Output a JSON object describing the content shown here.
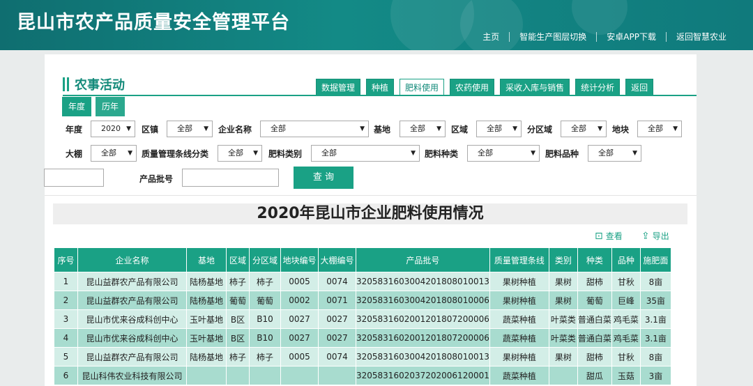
{
  "header": {
    "title": "昆山市农产品质量安全管理平台",
    "nav": [
      "主页",
      "智能生产图层切换",
      "安卓APP下载",
      "返回智慧农业"
    ]
  },
  "section": {
    "title": "农事活动"
  },
  "tabs": [
    {
      "label": "数据管理",
      "active": false
    },
    {
      "label": "种植",
      "active": false
    },
    {
      "label": "肥料使用",
      "active": true
    },
    {
      "label": "农药使用",
      "active": false
    },
    {
      "label": "采收入库与销售",
      "active": false
    },
    {
      "label": "统计分析",
      "active": false
    },
    {
      "label": "返回",
      "active": false
    }
  ],
  "year_tabs": [
    "年度",
    "历年"
  ],
  "filters": {
    "year": {
      "label": "年度",
      "value": "2020"
    },
    "town": {
      "label": "区镇",
      "value": "全部"
    },
    "company": {
      "label": "企业名称",
      "value": "全部"
    },
    "base": {
      "label": "基地",
      "value": "全部"
    },
    "zone": {
      "label": "区域",
      "value": "全部"
    },
    "subzone": {
      "label": "分区域",
      "value": "全部"
    },
    "plot": {
      "label": "地块",
      "value": "全部"
    },
    "greenhouse": {
      "label": "大棚",
      "value": "全部"
    },
    "quality_line": {
      "label": "质量管理条线分类",
      "value": "全部"
    },
    "fert_class": {
      "label": "肥料类别",
      "value": "全部"
    },
    "fert_kind": {
      "label": "肥料种类",
      "value": "全部"
    },
    "fert_variety": {
      "label": "肥料品种",
      "value": "全部"
    },
    "batch": {
      "label": "产品批号",
      "value": ""
    },
    "query_label": "查 询"
  },
  "report": {
    "title": "2020年昆山市企业肥料使用情况",
    "view_label": "查看",
    "export_label": "导出"
  },
  "table": {
    "headers": [
      "序号",
      "企业名称",
      "基地",
      "区域",
      "分区域",
      "地块编号",
      "大棚编号",
      "产品批号",
      "质量管理条线",
      "类别",
      "种类",
      "品种",
      "施肥面"
    ],
    "rows": [
      [
        "1",
        "昆山益群农产品有限公司",
        "陆杨基地",
        "柿子",
        "柿子",
        "0005",
        "0074",
        "320583160300420180801001​3",
        "果树种植",
        "果树",
        "甜柿",
        "甘秋",
        "8亩"
      ],
      [
        "2",
        "昆山益群农产品有限公司",
        "陆杨基地",
        "葡萄",
        "葡萄",
        "0002",
        "0071",
        "320583160300420180801000​6",
        "果树种植",
        "果树",
        "葡萄",
        "巨峰",
        "35亩"
      ],
      [
        "3",
        "昆山市优来谷成科创中心",
        "玉叶基地",
        "B区",
        "B10",
        "0027",
        "0027",
        "320583160200120180720000​6",
        "蔬菜种植",
        "叶菜类",
        "普通白菜",
        "鸡毛菜",
        "3.1亩"
      ],
      [
        "4",
        "昆山市优来谷成科创中心",
        "玉叶基地",
        "B区",
        "B10",
        "0027",
        "0027",
        "320583160200120180720000​6",
        "蔬菜种植",
        "叶菜类",
        "普通白菜",
        "鸡毛菜",
        "3.1亩"
      ],
      [
        "5",
        "昆山益群农产品有限公司",
        "陆杨基地",
        "柿子",
        "柿子",
        "0005",
        "0074",
        "320583160300420180801001​3",
        "果树种植",
        "果树",
        "甜柿",
        "甘秋",
        "8亩"
      ],
      [
        "6",
        "昆山科伟农业科技有限公司",
        "",
        "",
        "",
        "",
        "",
        "320583160203720200612000​1",
        "蔬菜种植",
        "",
        "甜瓜",
        "玉菇",
        "3亩"
      ]
    ]
  }
}
